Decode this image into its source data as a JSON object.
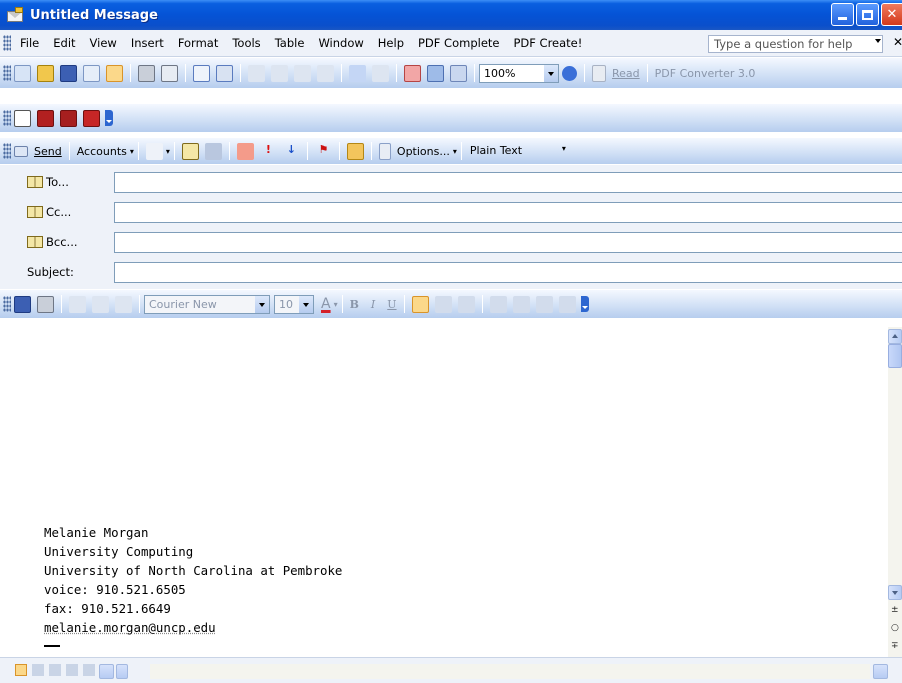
{
  "window": {
    "title": "Untitled Message",
    "controls": [
      "minimize",
      "maximize",
      "close"
    ]
  },
  "menu": {
    "items": [
      "File",
      "Edit",
      "View",
      "Insert",
      "Format",
      "Tools",
      "Table",
      "Window",
      "Help",
      "PDF Complete",
      "PDF Create!"
    ],
    "help_placeholder": "Type a question for help"
  },
  "standard_toolbar": {
    "zoom": "100%",
    "read_label": "Read",
    "pdf_converter_label": "PDF Converter 3.0"
  },
  "email_toolbar": {
    "send_label": "Send",
    "accounts_label": "Accounts",
    "options_label": "Options...",
    "format_value": "Plain Text"
  },
  "fields": {
    "to_label": "To...",
    "cc_label": "Cc...",
    "bcc_label": "Bcc...",
    "subject_label": "Subject:",
    "to_value": "",
    "cc_value": "",
    "bcc_value": "",
    "subject_value": ""
  },
  "format_toolbar": {
    "font": "Courier New",
    "size": "10",
    "bold": "B",
    "italic": "I",
    "underline": "U"
  },
  "body": {
    "signature": [
      "Melanie Morgan",
      "University Computing",
      "University of North Carolina at Pembroke",
      "voice: 910.521.6505",
      "fax: 910.521.6649",
      "melanie.morgan@uncp.edu"
    ]
  },
  "colors": {
    "titlebar": "#0553d6",
    "toolbar": "#cfdff5",
    "fields_bg": "#eef2f9"
  }
}
